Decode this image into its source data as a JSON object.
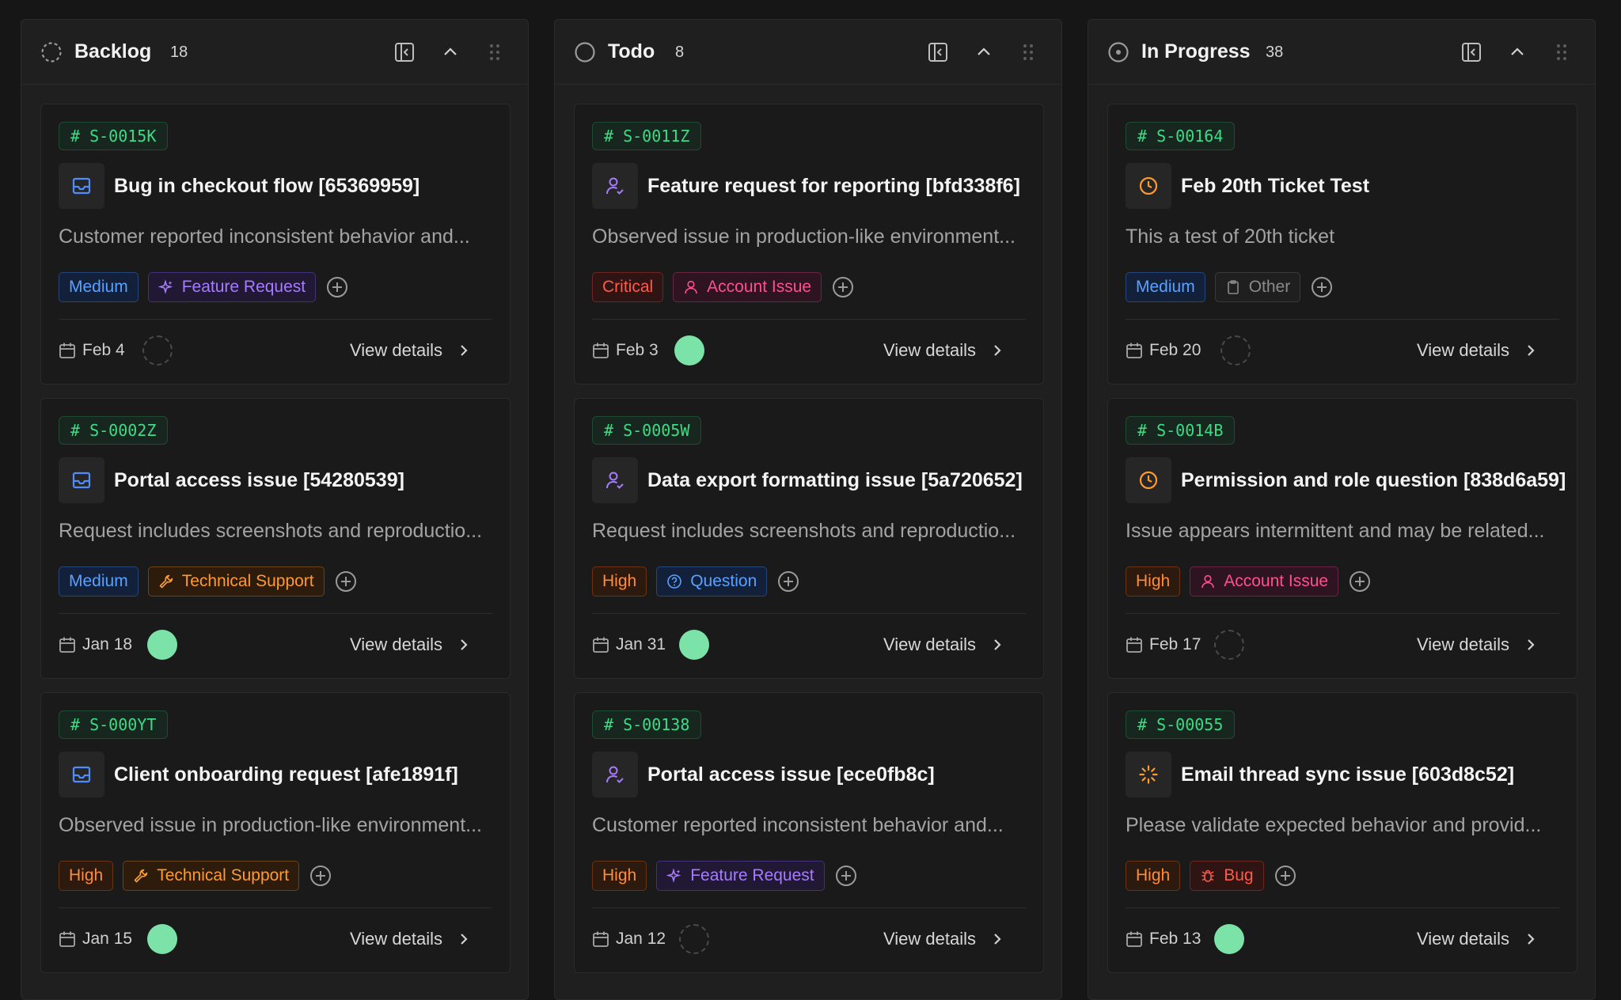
{
  "columns": [
    {
      "title": "Backlog",
      "count": "18",
      "cards": [
        {
          "id": "# S-0015K",
          "title": "Bug in checkout flow [65369959]",
          "desc": "Customer reported inconsistent behavior and...",
          "priority": "Medium",
          "category": "Feature Request",
          "date": "Feb 4",
          "action": "View details"
        },
        {
          "id": "# S-0002Z",
          "title": "Portal access issue [54280539]",
          "desc": "Request includes screenshots and reproductio...",
          "priority": "Medium",
          "category": "Technical Support",
          "date": "Jan 18",
          "action": "View details"
        },
        {
          "id": "# S-000YT",
          "title": "Client onboarding request [afe1891f]",
          "desc": "Observed issue in production-like environment...",
          "priority": "High",
          "category": "Technical Support",
          "date": "Jan 15",
          "action": "View details"
        }
      ]
    },
    {
      "title": "Todo",
      "count": "8",
      "cards": [
        {
          "id": "# S-0011Z",
          "title": "Feature request for reporting [bfd338f6]",
          "desc": "Observed issue in production-like environment...",
          "priority": "Critical",
          "category": "Account Issue",
          "date": "Feb 3",
          "action": "View details"
        },
        {
          "id": "# S-0005W",
          "title": "Data export formatting issue [5a720652]",
          "desc": "Request includes screenshots and reproductio...",
          "priority": "High",
          "category": "Question",
          "date": "Jan 31",
          "action": "View details"
        },
        {
          "id": "# S-00138",
          "title": "Portal access issue [ece0fb8c]",
          "desc": "Customer reported inconsistent behavior and...",
          "priority": "High",
          "category": "Feature Request",
          "date": "Jan 12",
          "action": "View details"
        }
      ]
    },
    {
      "title": "In Progress",
      "count": "38",
      "cards": [
        {
          "id": "# S-00164",
          "title": "Feb 20th Ticket Test",
          "desc": "This a test of 20th ticket",
          "priority": "Medium",
          "category": "Other",
          "date": "Feb 20",
          "action": "View details"
        },
        {
          "id": "# S-0014B",
          "title": "Permission and role question [838d6a59]",
          "desc": "Issue appears intermittent and may be related...",
          "priority": "High",
          "category": "Account Issue",
          "date": "Feb 17",
          "action": "View details"
        },
        {
          "id": "# S-00055",
          "title": "Email thread sync issue [603d8c52]",
          "desc": "Please validate expected behavior and provid...",
          "priority": "High",
          "category": "Bug",
          "date": "Feb 13",
          "action": "View details"
        }
      ]
    }
  ]
}
